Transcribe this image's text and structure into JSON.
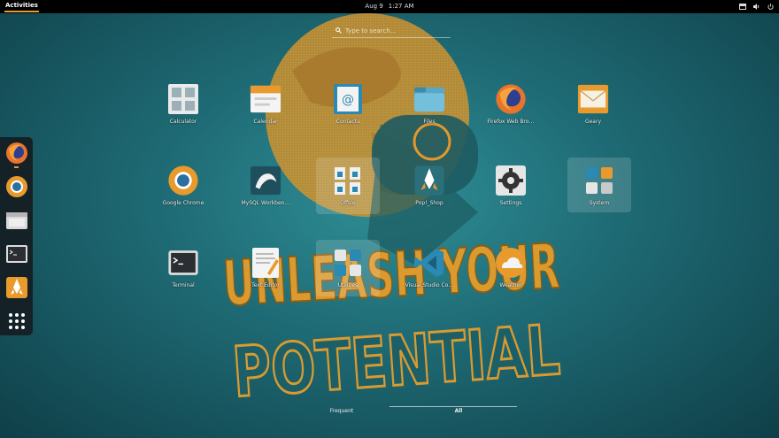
{
  "topbar": {
    "activities_label": "Activities",
    "date": "Aug 9",
    "time": "1:27 AM",
    "icons": [
      "screen-icon",
      "volume-icon",
      "power-icon"
    ]
  },
  "search": {
    "placeholder": "Type to search…"
  },
  "wallpaper": {
    "line1": "UNLEASH YOUR",
    "line2": "POTENTIAL"
  },
  "dash": {
    "items": [
      "firefox-icon",
      "chrome-icon",
      "files-icon",
      "terminal-icon",
      "pop-shop-icon",
      "show-apps-icon"
    ]
  },
  "apps": [
    {
      "label": "Calculator",
      "icon": "calculator-icon"
    },
    {
      "label": "Calendar",
      "icon": "calendar-icon"
    },
    {
      "label": "Contacts",
      "icon": "contacts-icon"
    },
    {
      "label": "Files",
      "icon": "files-icon"
    },
    {
      "label": "Firefox Web Bro…",
      "icon": "firefox-icon"
    },
    {
      "label": "Geary",
      "icon": "geary-icon"
    },
    {
      "label": "Google Chrome",
      "icon": "chrome-icon"
    },
    {
      "label": "MySQL Workben…",
      "icon": "mysql-icon"
    },
    {
      "label": "Office",
      "icon": "office-folder-icon"
    },
    {
      "label": "Pop!_Shop",
      "icon": "pop-shop-icon"
    },
    {
      "label": "Settings",
      "icon": "settings-icon"
    },
    {
      "label": "System",
      "icon": "system-folder-icon"
    },
    {
      "label": "Terminal",
      "icon": "terminal-icon"
    },
    {
      "label": "Text Editor",
      "icon": "text-editor-icon"
    },
    {
      "label": "Utilities",
      "icon": "utilities-folder-icon"
    },
    {
      "label": "Visual Studio Co…",
      "icon": "vscode-icon"
    },
    {
      "label": "Weather",
      "icon": "weather-icon"
    }
  ],
  "view_switch": {
    "frequent": "Frequent",
    "all": "All"
  },
  "colors": {
    "accent": "#e89a2c",
    "background": "#1f6c76",
    "panel": "#000000"
  }
}
